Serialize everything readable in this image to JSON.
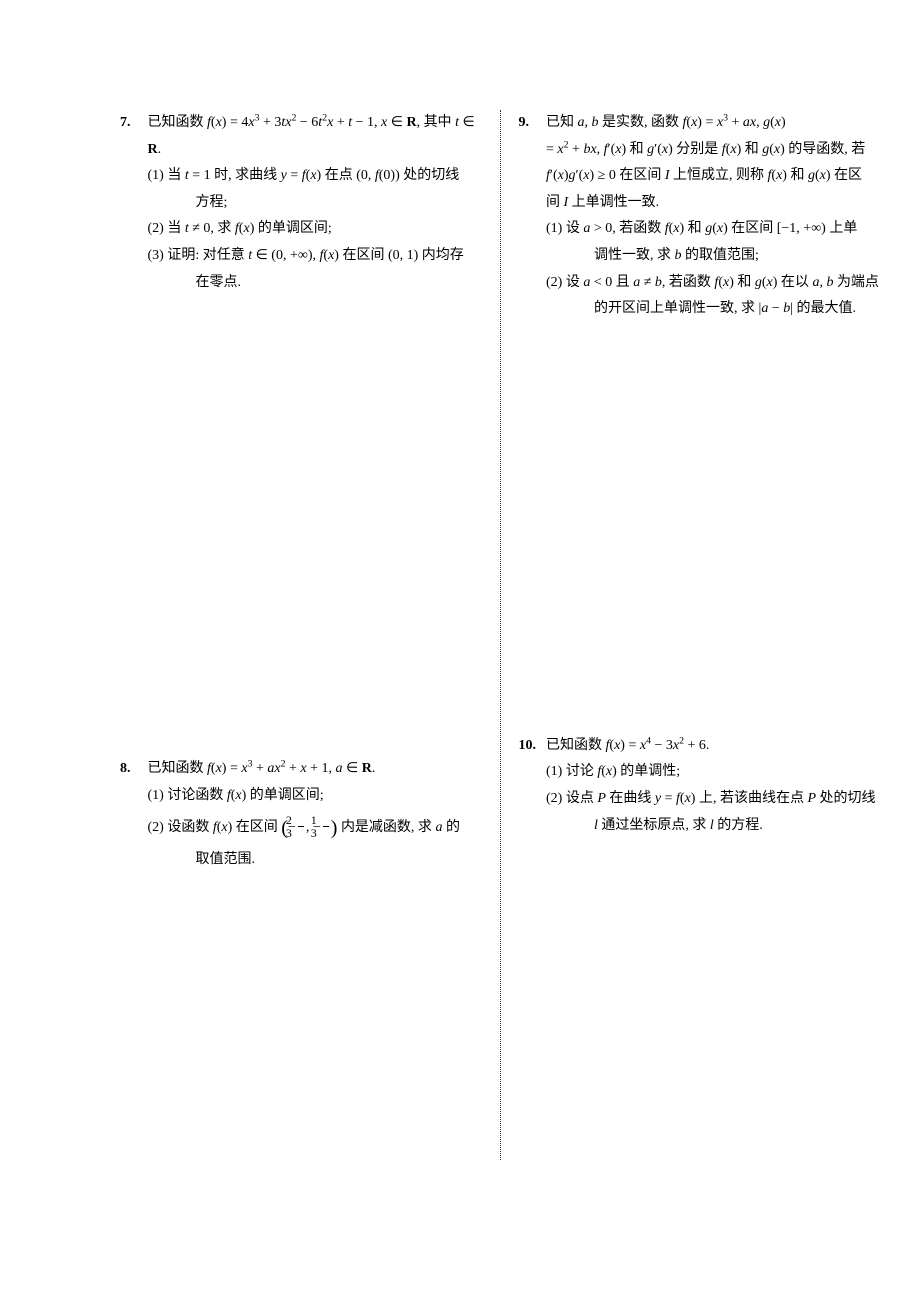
{
  "problems": {
    "p7": {
      "num": "7.",
      "stem": "已知函数 f(x) = 4x³ + 3tx² − 6t²x + t − 1, x ∈ 𝐑, 其中 t ∈ 𝐑.",
      "s1": "(1) 当 t = 1 时, 求曲线 y = f(x) 在点 (0, f(0)) 处的切线方程;",
      "s2": "(2) 当 t ≠ 0, 求 f(x) 的单调区间;",
      "s3": "(3) 证明: 对任意 t ∈ (0, +∞), f(x) 在区间 (0, 1) 内均存在零点."
    },
    "p8": {
      "num": "8.",
      "stem": "已知函数 f(x) = x³ + ax² + x + 1, a ∈ 𝐑.",
      "s1": "(1) 讨论函数 f(x) 的单调区间;",
      "s2a": "(2) 设函数 f(x) 在区间 ",
      "s2b": " 内是减函数, 求 a 的取值范围.",
      "frac1n": "2",
      "frac1d": "3",
      "frac2n": "1",
      "frac2d": "3"
    },
    "p9": {
      "num": "9.",
      "line1": "已知 a, b 是实数, 函数 f(x) = x³ + ax, g(x)",
      "line2": "= x² + bx, f′(x) 和 g′(x) 分别是 f(x) 和 g(x) 的导函数, 若",
      "line3": "f′(x)g′(x) ≥ 0 在区间 I 上恒成立, 则称 f(x) 和 g(x) 在区",
      "line4": "间 I 上单调性一致.",
      "s1": "(1) 设 a > 0, 若函数 f(x) 和 g(x) 在区间 [−1, +∞) 上单调性一致, 求 b 的取值范围;",
      "s2": "(2) 设 a < 0 且 a ≠ b, 若函数 f(x) 和 g(x) 在以 a, b 为端点的开区间上单调性一致, 求 |a − b| 的最大值."
    },
    "p10": {
      "num": "10.",
      "stem": "已知函数 f(x) = x⁴ − 3x² + 6.",
      "s1": "(1) 讨论 f(x) 的单调性;",
      "s2": "(2) 设点 P 在曲线 y = f(x) 上, 若该曲线在点 P 处的切线 l 通过坐标原点, 求 l 的方程."
    }
  }
}
